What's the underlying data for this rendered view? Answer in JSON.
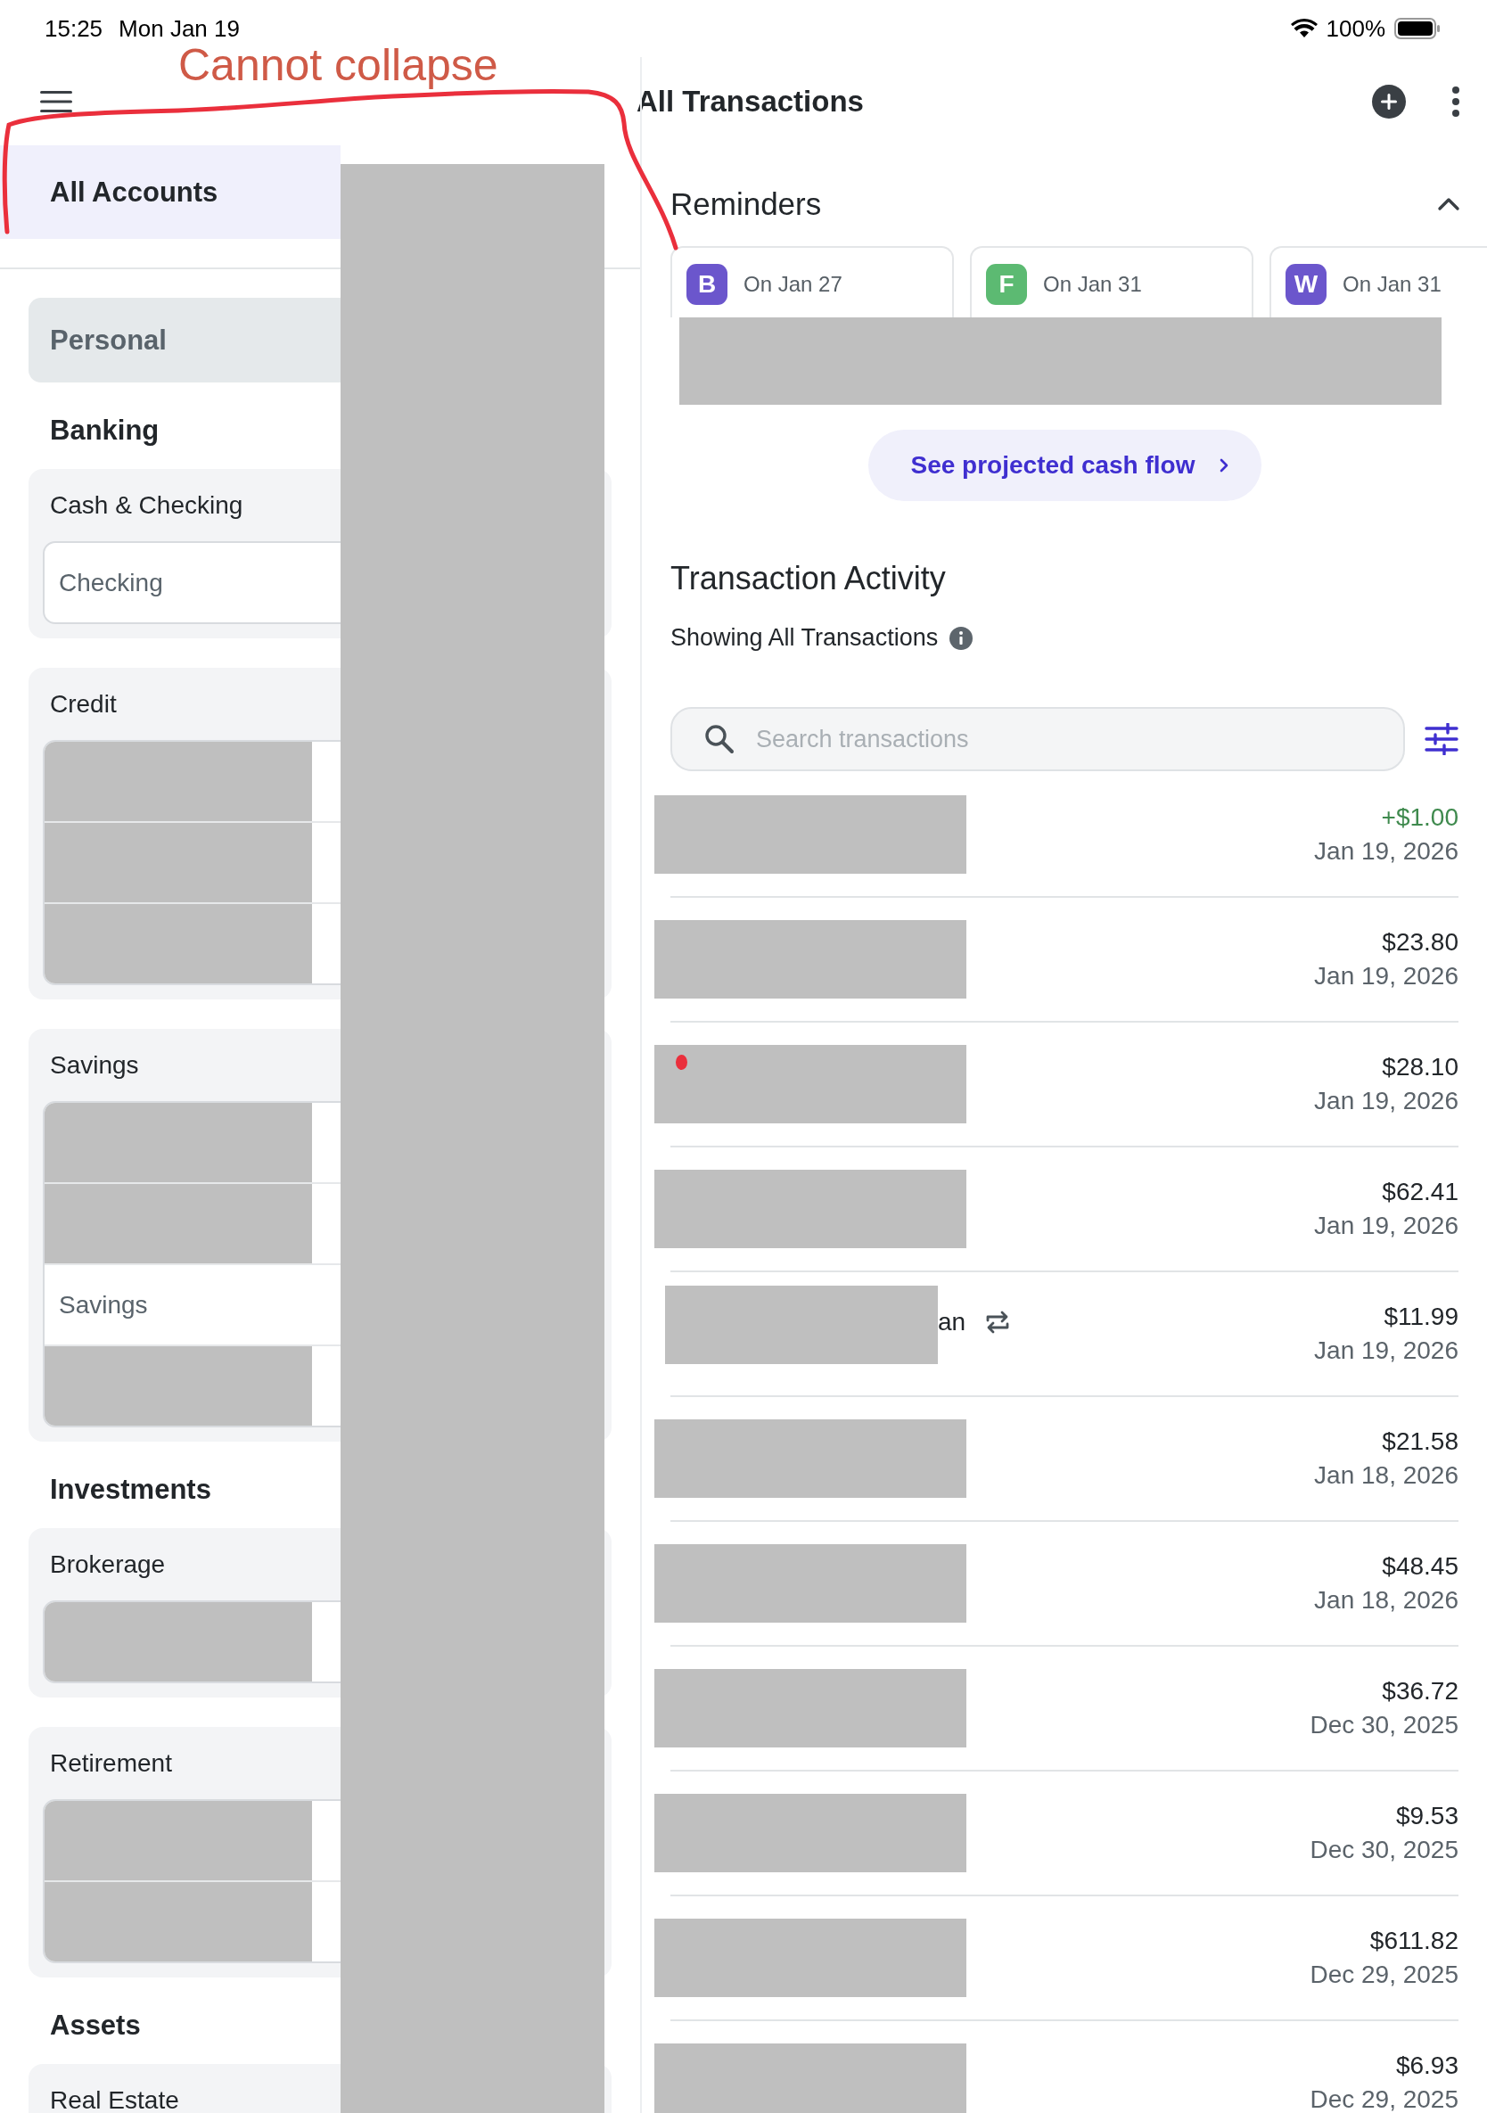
{
  "status_bar": {
    "time": "15:25",
    "date": "Mon Jan 19",
    "battery": "100%"
  },
  "annotation": {
    "text": "Cannot collapse"
  },
  "header": {
    "title": "All Transactions"
  },
  "sidebar": {
    "all_accounts": {
      "label": "All Accounts",
      "selected": true
    },
    "group": {
      "label": "Personal"
    },
    "sections": [
      {
        "title": "Banking",
        "cards": [
          {
            "title": "Cash & Checking",
            "accounts": [
              {
                "label": "Checking",
                "redacted": false
              }
            ]
          },
          {
            "title": "Credit",
            "accounts": [
              {
                "redacted": true
              },
              {
                "redacted": true
              },
              {
                "redacted": true
              }
            ]
          },
          {
            "title": "Savings",
            "accounts": [
              {
                "redacted": true
              },
              {
                "redacted": true
              },
              {
                "label": "Savings",
                "redacted": false
              },
              {
                "redacted": true
              }
            ]
          }
        ]
      },
      {
        "title": "Investments",
        "cards": [
          {
            "title": "Brokerage",
            "accounts": [
              {
                "redacted": true
              }
            ]
          },
          {
            "title": "Retirement",
            "accounts": [
              {
                "redacted": true
              },
              {
                "redacted": true
              }
            ]
          }
        ]
      },
      {
        "title": "Assets",
        "cards": [
          {
            "title": "Real Estate"
          }
        ]
      }
    ]
  },
  "reminders": {
    "title": "Reminders",
    "expanded": true,
    "cards": [
      {
        "initial": "B",
        "color": "#6b56cc",
        "date": "On Jan 27"
      },
      {
        "initial": "F",
        "color": "#5cba72",
        "date": "On Jan 31"
      },
      {
        "initial": "W",
        "color": "#6b56cc",
        "date": "On Jan 31"
      }
    ],
    "cash_flow_button": "See projected cash flow"
  },
  "activity": {
    "title": "Transaction Activity",
    "subtitle": "Showing All Transactions",
    "search": {
      "placeholder": "Search transactions"
    },
    "transactions": [
      {
        "amount": "+$1.00",
        "date": "Jan 19, 2026",
        "income": true,
        "recurring": false
      },
      {
        "amount": "$23.80",
        "date": "Jan 19, 2026",
        "income": false,
        "recurring": false
      },
      {
        "amount": "$28.10",
        "date": "Jan 19, 2026",
        "income": false,
        "recurring": false
      },
      {
        "amount": "$62.41",
        "date": "Jan 19, 2026",
        "income": false,
        "recurring": false
      },
      {
        "name_fragment": "an",
        "amount": "$11.99",
        "date": "Jan 19, 2026",
        "income": false,
        "recurring": true
      },
      {
        "amount": "$21.58",
        "date": "Jan 18, 2026",
        "income": false,
        "recurring": false
      },
      {
        "amount": "$48.45",
        "date": "Jan 18, 2026",
        "income": false,
        "recurring": false
      },
      {
        "amount": "$36.72",
        "date": "Dec 30, 2025",
        "income": false,
        "recurring": false
      },
      {
        "amount": "$9.53",
        "date": "Dec 30, 2025",
        "income": false,
        "recurring": false
      },
      {
        "amount": "$611.82",
        "date": "Dec 29, 2025",
        "income": false,
        "recurring": false
      },
      {
        "amount": "$6.93",
        "date": "Dec 29, 2025",
        "income": false,
        "recurring": false
      }
    ]
  }
}
